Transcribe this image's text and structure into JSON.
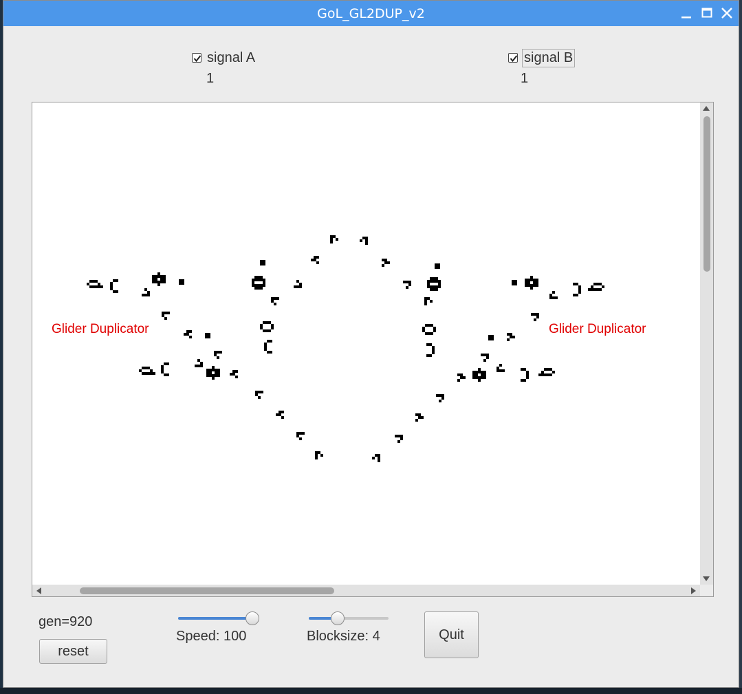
{
  "window": {
    "title": "GoL_GL2DUP_v2",
    "titlebar_color": "#4c97ea",
    "controls": [
      "minimize-icon",
      "maximize-icon",
      "close-icon"
    ]
  },
  "signals": {
    "a": {
      "label": "signal A",
      "checked": true,
      "value": "1"
    },
    "b": {
      "label": "signal B",
      "checked": true,
      "value": "1"
    }
  },
  "canvas": {
    "labels": [
      "Glider Duplicator",
      "Glider Duplicator"
    ],
    "label_color": "#e00000",
    "cell_color": "#000000",
    "background": "#ffffff"
  },
  "status": {
    "generation": "gen=920"
  },
  "buttons": {
    "reset": "reset",
    "quit": "Quit"
  },
  "sliders": {
    "speed": {
      "label": "Speed: 100",
      "value": 100,
      "fraction": 0.92
    },
    "blocksize": {
      "label": "Blocksize: 4",
      "value": 4,
      "fraction": 0.35
    }
  },
  "scrollbars": {
    "vertical_position_fraction": 0.0,
    "horizontal_position_fraction": 0.07
  }
}
